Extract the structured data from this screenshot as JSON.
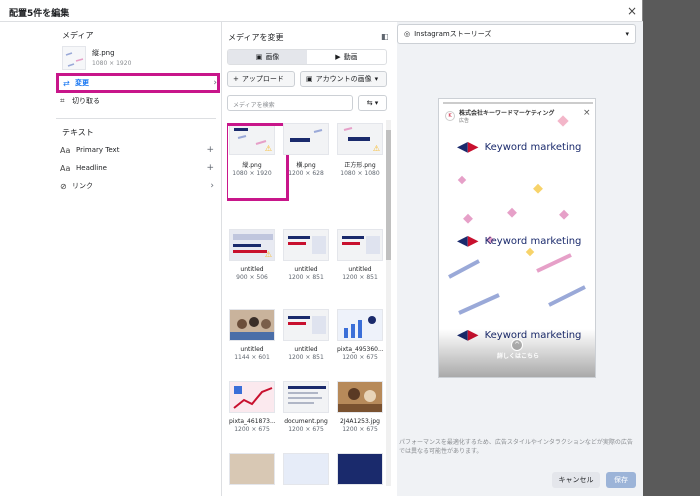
{
  "dialog": {
    "title": "配置5件を編集",
    "close": "×"
  },
  "left": {
    "media_title": "メディア",
    "media_file": "縦.png",
    "media_size": "1080 × 1920",
    "change_label": "変更",
    "crop_label": "切り取る",
    "text_title": "テキスト",
    "text_items": [
      {
        "label": "Primary Text"
      },
      {
        "label": "Headline"
      },
      {
        "label": "リンク"
      }
    ]
  },
  "middle": {
    "title": "メディアを変更",
    "tabs": [
      "画像",
      "動画"
    ],
    "upload": "アップロード",
    "account_images": "アカウントの画像",
    "search_placeholder": "メディアを検索",
    "items": [
      {
        "name": "縦.png",
        "size": "1080 × 1920",
        "warn": true
      },
      {
        "name": "横.png",
        "size": "1200 × 628",
        "warn": false
      },
      {
        "name": "正方形.png",
        "size": "1080 × 1080",
        "warn": true
      },
      {
        "name": "untitled",
        "size": "900 × 506",
        "warn": true
      },
      {
        "name": "untitled",
        "size": "1200 × 851",
        "warn": false
      },
      {
        "name": "untitled",
        "size": "1200 × 851",
        "warn": false
      },
      {
        "name": "untitled",
        "size": "1144 × 601",
        "warn": false
      },
      {
        "name": "untitled",
        "size": "1200 × 851",
        "warn": false
      },
      {
        "name": "pixta_495360...",
        "size": "1200 × 675",
        "warn": false
      },
      {
        "name": "pixta_461873...",
        "size": "1200 × 675",
        "warn": false
      },
      {
        "name": "document.png",
        "size": "1200 × 675",
        "warn": false
      },
      {
        "name": "2J4A1253.jpg",
        "size": "1200 × 675",
        "warn": false
      }
    ]
  },
  "preview": {
    "placement": "Instagramストーリーズ",
    "company": "株式会社キーワードマーケティング",
    "sponsored": "広告",
    "brand": "Keyword marketing",
    "cta": "詳しくはこちら",
    "note": "パフォーマンスを最適化するため、広告スタイルやインタラクションなどが実際の広告では異なる可能性があります。",
    "cancel": "キャンセル",
    "save": "保存"
  },
  "colors": {
    "highlight": "#c8168a",
    "accent": "#1877f2",
    "brand_navy": "#1a2a6c",
    "brand_red": "#c8102e"
  }
}
